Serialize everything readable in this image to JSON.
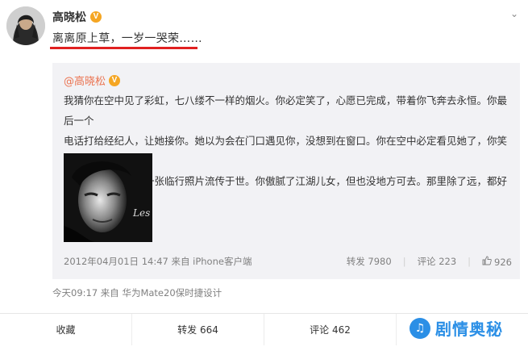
{
  "post": {
    "author": "高晓松",
    "badge_icon": "verified-v-icon",
    "text": "离离原上草，一岁一哭荣……",
    "more_icon": "chevron-down-icon"
  },
  "repost": {
    "author": "@高晓松",
    "lines": [
      "我猜你在空中见了彩虹，七八缕不一样的烟火。你必定笑了，心愿已完成，带着你飞奔去永恒。你最后一个",
      "电话打给经纪人，让她接你。她以为会在门口遇见你，没想到在窗口。你在空中必定看见她了，你笑了，知",
      "道她会尽忠，不让一张临行照片流传于世。你傲腻了江湖儿女，但也没地方可去。那里除了远，都好吧？"
    ],
    "image_caption": "Les",
    "timestamp_source": "2012年04月01日 14:47 来自 iPhone客户端",
    "repost_count": "转发 7980",
    "comment_count": "评论 223",
    "like_count": "926"
  },
  "device_line": "今天09:17 来自 华为Mate20保时捷设计",
  "actions": {
    "favorite": "收藏",
    "forward": "转发 664",
    "comment": "评论 462",
    "like": ""
  },
  "watermark": "剧情奥秘",
  "colors": {
    "accent_orange": "#eb7350",
    "highlight_red": "#e02020",
    "watermark_blue": "#2b8fe6"
  }
}
